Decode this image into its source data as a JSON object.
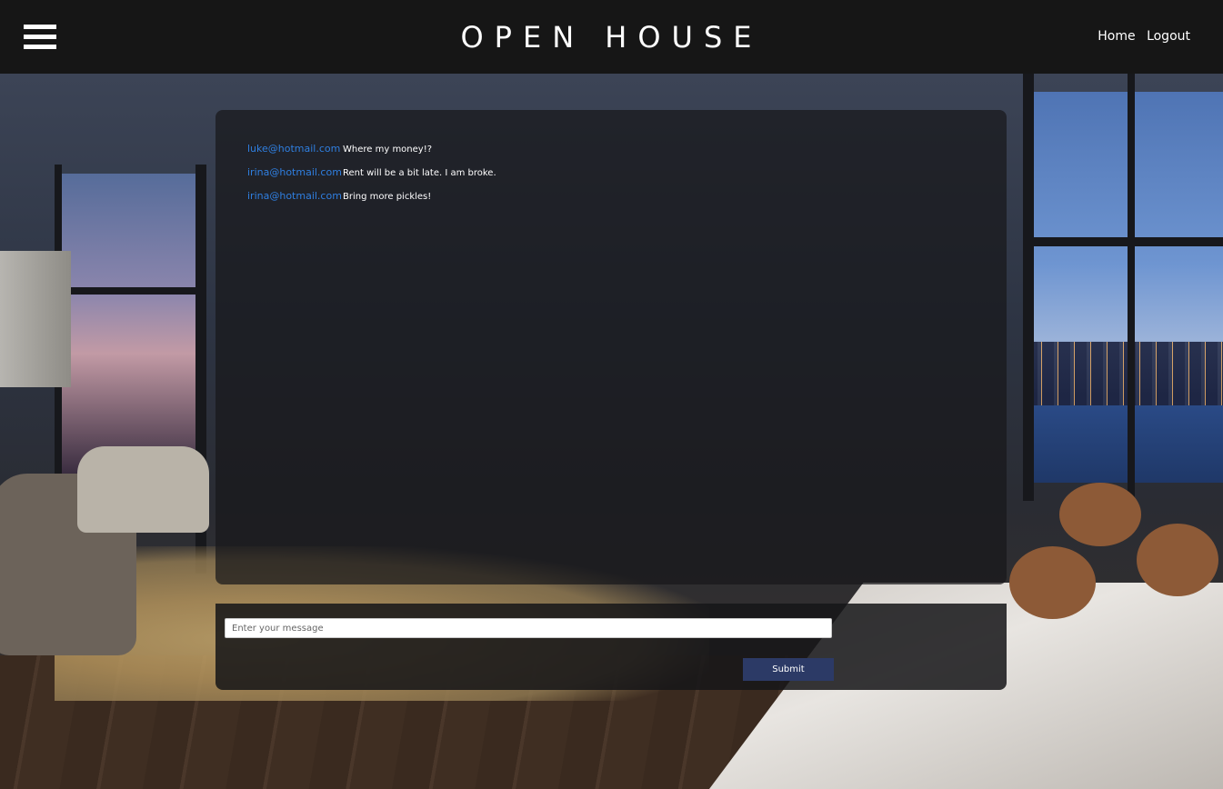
{
  "header": {
    "brand": "OPEN HOUSE",
    "nav": {
      "home_label": "Home",
      "logout_label": "Logout"
    }
  },
  "chat": {
    "messages": [
      {
        "author": "luke@hotmail.com",
        "text": "Where my money!?"
      },
      {
        "author": "irina@hotmail.com",
        "text": "Rent will be a bit late. I am broke."
      },
      {
        "author": "irina@hotmail.com",
        "text": "Bring more pickles!"
      }
    ],
    "input": {
      "placeholder": "Enter your message",
      "value": ""
    },
    "submit_label": "Submit"
  },
  "colors": {
    "header_bg": "#161616",
    "author_link": "#2f7fe0",
    "submit_bg": "#2c3a66"
  },
  "icons": {
    "menu": "hamburger-menu-icon"
  }
}
